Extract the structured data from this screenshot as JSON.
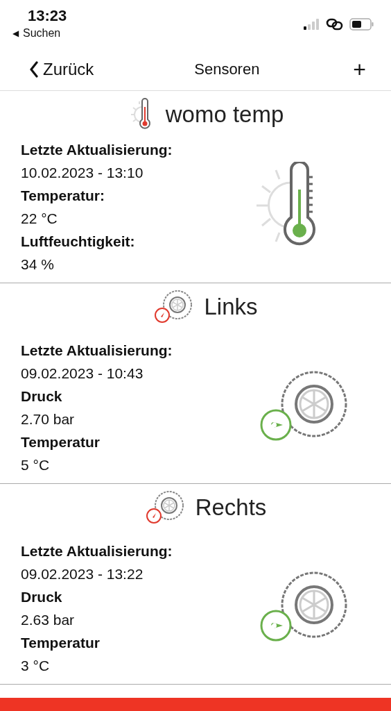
{
  "status_bar": {
    "time": "13:23",
    "back_app": "Suchen",
    "back_arrow": "◀"
  },
  "nav_bar": {
    "back": "Zurück",
    "title": "Sensoren",
    "add": "+"
  },
  "sensors": [
    {
      "kind": "thermometer",
      "name": "womo temp",
      "fields": [
        {
          "label": "Letzte Aktualisierung:",
          "value": "10.02.2023 - 13:10"
        },
        {
          "label": "Temperatur:",
          "value": "22 °C"
        },
        {
          "label": "Luftfeuchtigkeit:",
          "value": "34 %"
        }
      ]
    },
    {
      "kind": "tire",
      "name": "Links",
      "fields": [
        {
          "label": "Letzte Aktualisierung:",
          "value": "09.02.2023 - 10:43"
        },
        {
          "label": "Druck",
          "value": "2.70 bar"
        },
        {
          "label": "Temperatur",
          "value": "5 °C"
        }
      ]
    },
    {
      "kind": "tire",
      "name": "Rechts",
      "fields": [
        {
          "label": "Letzte Aktualisierung:",
          "value": "09.02.2023 - 13:22"
        },
        {
          "label": "Druck",
          "value": "2.63 bar"
        },
        {
          "label": "Temperatur",
          "value": "3 °C"
        }
      ]
    }
  ]
}
